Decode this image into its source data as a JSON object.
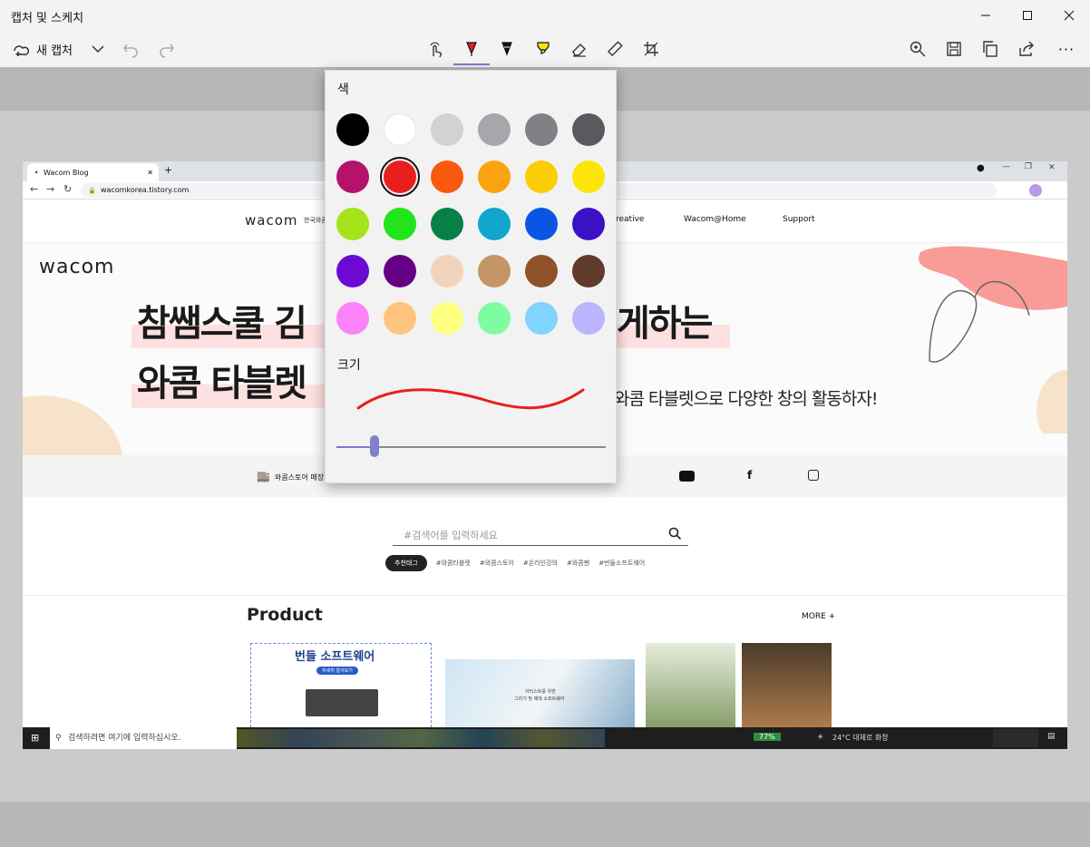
{
  "window": {
    "title": "캡처 및 스케치"
  },
  "toolbar": {
    "new_capture_label": "새 캡처",
    "tools": [
      "touch-writing-icon",
      "ballpoint-pen-icon",
      "pencil-icon",
      "highlighter-icon",
      "eraser-icon",
      "ruler-icon",
      "crop-icon"
    ],
    "right_tools": [
      "zoom-icon",
      "save-icon",
      "copy-icon",
      "share-icon",
      "more-icon"
    ],
    "more_label": "···"
  },
  "pen_panel": {
    "color_label": "색",
    "size_label": "크기",
    "selected_color": "#e81e1e",
    "colors": [
      "#000000",
      "#ffffff",
      "#d1d2d4",
      "#a6a7aa",
      "#808184",
      "#585a5d",
      "#b4126b",
      "#e81e1e",
      "#f75a0f",
      "#fba211",
      "#fccc06",
      "#fde50b",
      "#a6e41a",
      "#22e41a",
      "#078048",
      "#12a6cc",
      "#0a56e3",
      "#3c11c4",
      "#6b0ad2",
      "#650086",
      "#f4d3bd",
      "#c49567",
      "#8d5228",
      "#603a2b",
      "#fc82f8",
      "#fec47f",
      "#fefe81",
      "#7efc9f",
      "#80d4fd",
      "#bcb4fd"
    ],
    "size_value": 0.14
  },
  "screenshot": {
    "tab_title": "Wacom Blog",
    "url": "wacomkorea.tistory.com",
    "nav_logo": "wacom",
    "nav_sub": "한국와콤",
    "nav_items": [
      "reative",
      "Wacom@Home",
      "Support"
    ],
    "hero_logo": "wacom",
    "hero_line1_a": "참쌤스쿨 김",
    "hero_line1_b": "게하는",
    "hero_line2": "와콤 타블렛",
    "hero_sub": "와콤 타블렛으로 다양한 창의 활동하자!",
    "store_label": "와콤스토어 매장",
    "search_placeholder": "#검색어를 입력하세요",
    "rec_tag": "추천태그",
    "tags": [
      "#와콤타블렛",
      "#와콤스토어",
      "#온라인강의",
      "#와콤펜",
      "#번들소프트웨어"
    ],
    "product_title": "Product",
    "more_label": "MORE +",
    "card1_title": "번들 소프트웨어",
    "card1_badge": "자세히 알아보기",
    "card2_text_1": "아티스트를 위한",
    "card2_text_2": "그리기 및 채색 소프트웨어",
    "taskbar_search": "검색하려면 여기에 입력하십시오.",
    "battery": "77%",
    "weather": "24°C  대체로 화창"
  },
  "accent": "#7a7ad6"
}
